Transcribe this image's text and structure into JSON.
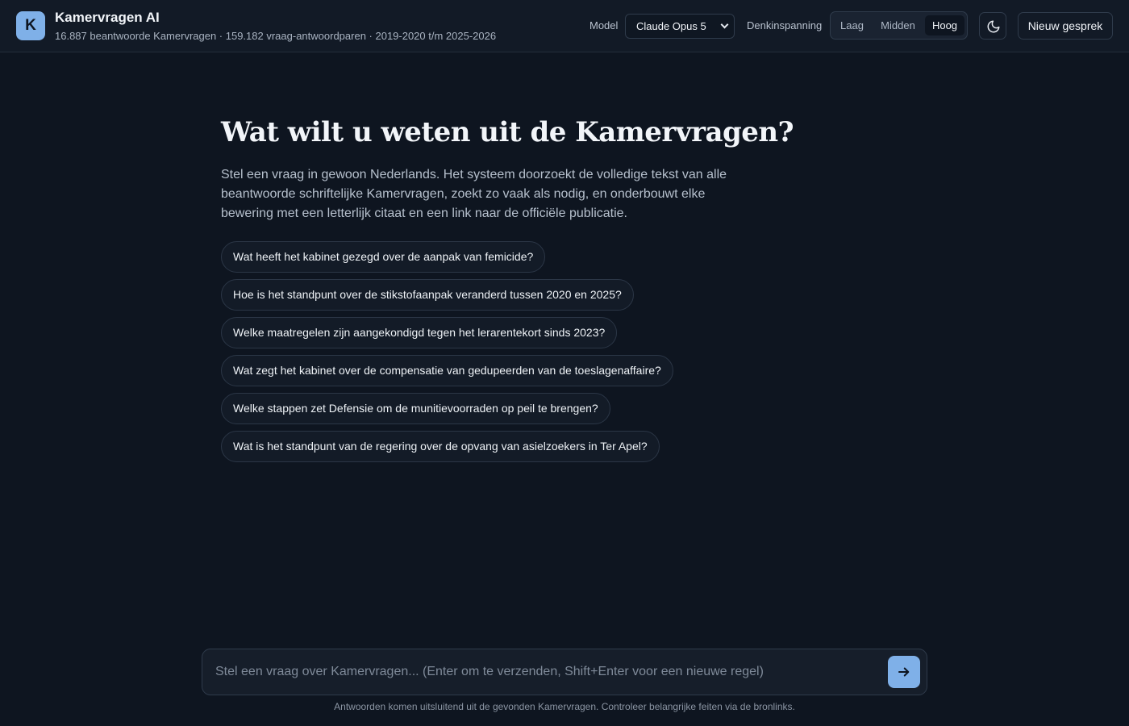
{
  "header": {
    "logo_letter": "K",
    "title": "Kamervragen AI",
    "subtitle": "16.887 beantwoorde Kamervragen · 159.182 vraag-antwoordparen · 2019-2020 t/m 2025-2026",
    "model_label": "Model",
    "model_value": "Claude Opus 5",
    "effort_label": "Denkinspanning",
    "effort_options": [
      "Laag",
      "Midden",
      "Hoog"
    ],
    "effort_selected": "Hoog",
    "theme_icon": "moon-icon",
    "new_chat_label": "Nieuw gesprek"
  },
  "main": {
    "title": "Wat wilt u weten uit de Kamervragen?",
    "description": "Stel een vraag in gewoon Nederlands. Het systeem doorzoekt de volledige tekst van alle beantwoorde schriftelijke Kamervragen, zoekt zo vaak als nodig, en onderbouwt elke bewering met een letterlijk citaat en een link naar de officiële publicatie.",
    "suggestions": [
      "Wat heeft het kabinet gezegd over de aanpak van femicide?",
      "Hoe is het standpunt over de stikstofaanpak veranderd tussen 2020 en 2025?",
      "Welke maatregelen zijn aangekondigd tegen het lerarentekort sinds 2023?",
      "Wat zegt het kabinet over de compensatie van gedupeerden van de toeslagenaffaire?",
      "Welke stappen zet Defensie om de munitievoorraden op peil te brengen?",
      "Wat is het standpunt van de regering over de opvang van asielzoekers in Ter Apel?"
    ]
  },
  "composer": {
    "placeholder": "Stel een vraag over Kamervragen... (Enter om te verzenden, Shift+Enter voor een nieuwe regel)",
    "send_icon": "arrow-right-icon"
  },
  "footer": {
    "note": "Antwoorden komen uitsluitend uit de gevonden Kamervragen. Controleer belangrijke feiten via de bronlinks."
  },
  "colors": {
    "background": "#0e1520",
    "accent": "#7fb0e8"
  }
}
